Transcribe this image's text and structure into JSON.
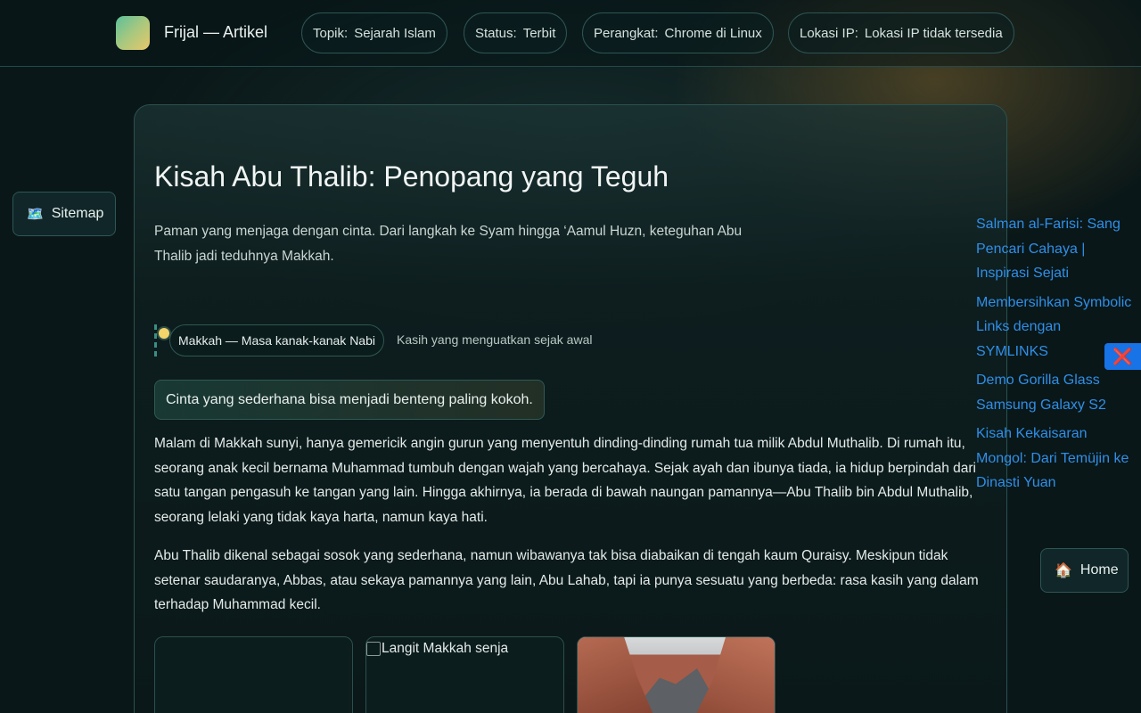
{
  "header": {
    "brand": "Frijal — Artikel",
    "pills": [
      {
        "key": "Topik:",
        "value": "Sejarah Islam"
      },
      {
        "key": "Status:",
        "value": "Terbit"
      },
      {
        "key": "Perangkat:",
        "value": "Chrome di Linux"
      },
      {
        "key": "Lokasi IP:",
        "value": "Lokasi IP tidak tersedia"
      }
    ]
  },
  "article": {
    "title": "Kisah Abu Thalib: Penopang yang Teguh",
    "lead": "Paman yang menjaga dengan cinta. Dari langkah ke Syam hingga ‘Aamul Huzn, keteguhan Abu Thalib jadi teduhnya Makkah.",
    "timeline": {
      "label": "Makkah — Masa kanak-kanak Nabi",
      "note": "Kasih yang menguatkan sejak awal"
    },
    "quote": "Cinta yang sederhana bisa menjadi benteng paling kokoh.",
    "paragraphs": [
      "Malam di Makkah sunyi, hanya gemericik angin gurun yang menyentuh dinding-dinding rumah tua milik Abdul Muthalib. Di rumah itu, seorang anak kecil bernama Muhammad tumbuh dengan wajah yang bercahaya. Sejak ayah dan ibunya tiada, ia hidup berpindah dari satu tangan pengasuh ke tangan yang lain. Hingga akhirnya, ia berada di bawah naungan pamannya—Abu Thalib bin Abdul Muthalib, seorang lelaki yang tidak kaya harta, namun kaya hati.",
      "Abu Thalib dikenal sebagai sosok yang sederhana, namun wibawanya tak bisa diabaikan di tengah kaum Quraisy. Meskipun tidak setenar saudaranya, Abbas, atau sekaya pamannya yang lain, Abu Lahab, tapi ia punya sesuatu yang berbeda: rasa kasih yang dalam terhadap Muhammad kecil."
    ],
    "images": [
      {
        "alt": ""
      },
      {
        "alt": "Langit Makkah senja"
      },
      {
        "alt": ""
      }
    ]
  },
  "sitemap": {
    "icon": "🗺️",
    "label": "Sitemap"
  },
  "related_links": [
    "Salman al-Farisi: Sang Pencari Cahaya | Inspirasi Sejati",
    "Membersihkan Symbolic Links dengan SYMLINKS",
    "Demo Gorilla Glass Samsung Galaxy S2",
    "Kisah Kekaisaran Mongol: Dari Temüjin ke Dinasti Yuan"
  ],
  "close_icon": "❌",
  "home": {
    "icon": "🏠",
    "label": "Home"
  }
}
